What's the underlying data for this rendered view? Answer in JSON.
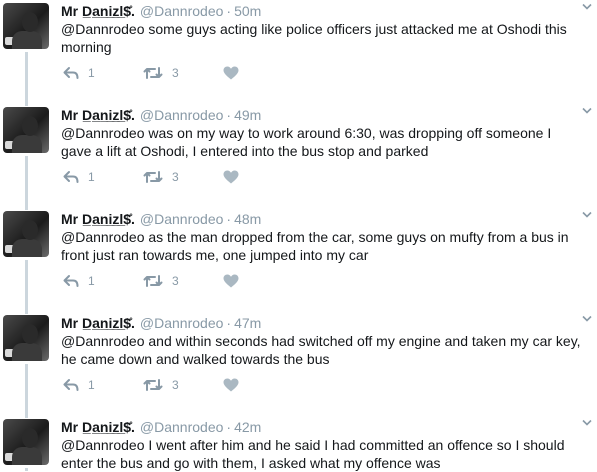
{
  "tweets": [
    {
      "name": "Mr D̲a̲n̲i̲z̲l̲$̊.",
      "handle": "@Dannrodeo",
      "separator": "·",
      "time": "50m",
      "text": "@Dannrodeo some guys acting like police officers just attacked me at Oshodi this morning",
      "replies": "1",
      "retweets": "3"
    },
    {
      "name": "Mr D̲a̲n̲i̲z̲l̲$̊.",
      "handle": "@Dannrodeo",
      "separator": "·",
      "time": "49m",
      "text": "@Dannrodeo was on my way to work around 6:30, was dropping off someone I gave a lift at Oshodi, I entered into the bus stop and parked",
      "replies": "1",
      "retweets": "3"
    },
    {
      "name": "Mr D̲a̲n̲i̲z̲l̲$̊.",
      "handle": "@Dannrodeo",
      "separator": "·",
      "time": "48m",
      "text": "@Dannrodeo as the man dropped from the car, some guys on mufty from a bus in front just ran towards me, one jumped into my car",
      "replies": "1",
      "retweets": "3"
    },
    {
      "name": "Mr D̲a̲n̲i̲z̲l̲$̊.",
      "handle": "@Dannrodeo",
      "separator": "·",
      "time": "47m",
      "text": "@Dannrodeo and within seconds had switched off my engine and taken my car key, he came down and walked towards the bus",
      "replies": "1",
      "retweets": "3"
    },
    {
      "name": "Mr D̲a̲n̲i̲z̲l̲$̊.",
      "handle": "@Dannrodeo",
      "separator": "·",
      "time": "42m",
      "text": "@Dannrodeo I went after him and he said I had committed an offence so I should enter the bus and go with them,  I asked what my offence was",
      "replies": "",
      "retweets": ""
    }
  ],
  "icons": {
    "reply": "reply-icon",
    "retweet": "retweet-icon",
    "like": "heart-icon",
    "more": "chevron-down-icon"
  },
  "colors": {
    "meta": "#8899a6",
    "thread_line": "#ccd6dd",
    "text": "#14171a"
  }
}
